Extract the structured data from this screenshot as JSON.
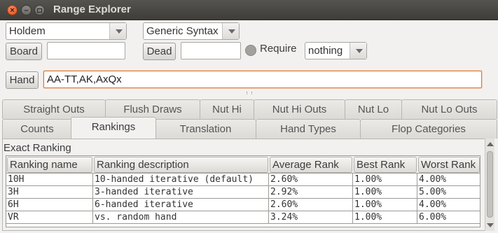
{
  "window": {
    "title": "Range Explorer"
  },
  "controls": {
    "game_select": "Holdem",
    "syntax_select": "Generic Syntax",
    "board_label": "Board",
    "board_value": "",
    "dead_label": "Dead",
    "dead_value": "",
    "require_label": "Require",
    "require_select": "nothing",
    "hand_label": "Hand",
    "hand_value": "AA-TT,AK,AxQx"
  },
  "tabs_row1": [
    {
      "label": "Straight Outs"
    },
    {
      "label": "Flush Draws"
    },
    {
      "label": "Nut Hi"
    },
    {
      "label": "Nut Hi Outs"
    },
    {
      "label": "Nut Lo"
    },
    {
      "label": "Nut Lo Outs"
    }
  ],
  "tabs_row2": [
    {
      "label": "Counts"
    },
    {
      "label": "Rankings"
    },
    {
      "label": "Translation"
    },
    {
      "label": "Hand Types"
    },
    {
      "label": "Flop Categories"
    }
  ],
  "selected_tab": "Rankings",
  "section": {
    "title": "Exact Ranking"
  },
  "table": {
    "columns": [
      "Ranking name",
      "Ranking description",
      "Average Rank",
      "Best Rank",
      "Worst Rank"
    ],
    "rows": [
      [
        "10H",
        "10-handed iterative (default)",
        "2.60%",
        "1.00%",
        "4.00%"
      ],
      [
        "3H",
        "3-handed iterative",
        "2.92%",
        "1.00%",
        "5.00%"
      ],
      [
        "6H",
        "6-handed iterative",
        "2.60%",
        "1.00%",
        "4.00%"
      ],
      [
        "VR",
        "vs. random hand",
        "3.24%",
        "1.00%",
        "6.00%"
      ]
    ]
  }
}
